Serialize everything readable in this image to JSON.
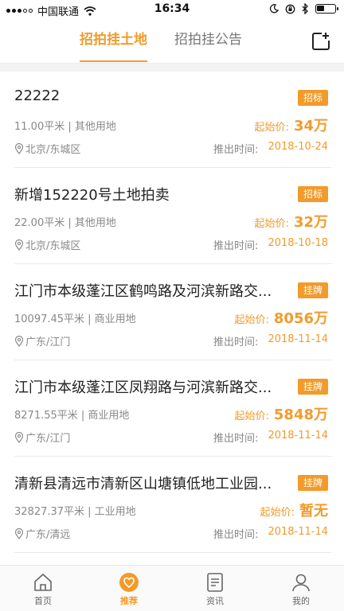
{
  "status_bar": {
    "carrier": "中国联通",
    "time": "16:34",
    "battery_level": 0.45
  },
  "header": {
    "tabs": [
      {
        "label": "招拍挂土地",
        "active": true
      },
      {
        "label": "招拍挂公告",
        "active": false
      }
    ],
    "add_icon": "add-square-icon"
  },
  "listings": [
    {
      "title": "22222",
      "badge": "招标",
      "area": "11.00平米 | 其他用地",
      "price_label": "起始价:",
      "price": "34万",
      "location": "北京/东城区",
      "date_label": "推出时间:",
      "date": "2018-10-24"
    },
    {
      "title": "新增152220号土地拍卖",
      "badge": "招标",
      "area": "22.00平米 | 其他用地",
      "price_label": "起始价:",
      "price": "32万",
      "location": "北京/东城区",
      "date_label": "推出时间:",
      "date": "2018-10-18"
    },
    {
      "title": "江门市本级蓬江区鹤鸣路及河滨新路交...",
      "badge": "挂牌",
      "area": "10097.45平米 | 商业用地",
      "price_label": "起始价:",
      "price": "8056万",
      "location": "广东/江门",
      "date_label": "推出时间:",
      "date": "2018-11-14"
    },
    {
      "title": "江门市本级蓬江区凤翔路与河滨新路交...",
      "badge": "挂牌",
      "area": "8271.55平米 | 商业用地",
      "price_label": "起始价:",
      "price": "5848万",
      "location": "广东/江门",
      "date_label": "推出时间:",
      "date": "2018-11-14"
    },
    {
      "title": "清新县清远市清新区山塘镇低地工业园...",
      "badge": "挂牌",
      "area": "32827.37平米 | 工业用地",
      "price_label": "起始价:",
      "price": "暂无",
      "location": "广东/清远",
      "date_label": "推出时间:",
      "date": "2018-11-14"
    }
  ],
  "bottom_nav": [
    {
      "label": "首页",
      "icon": "home-icon",
      "active": false
    },
    {
      "label": "推荐",
      "icon": "heart-icon",
      "active": true
    },
    {
      "label": "资讯",
      "icon": "news-icon",
      "active": false
    },
    {
      "label": "我的",
      "icon": "user-icon",
      "active": false
    }
  ],
  "colors": {
    "accent": "#f29b2a",
    "text": "#222222",
    "muted": "#888888"
  }
}
